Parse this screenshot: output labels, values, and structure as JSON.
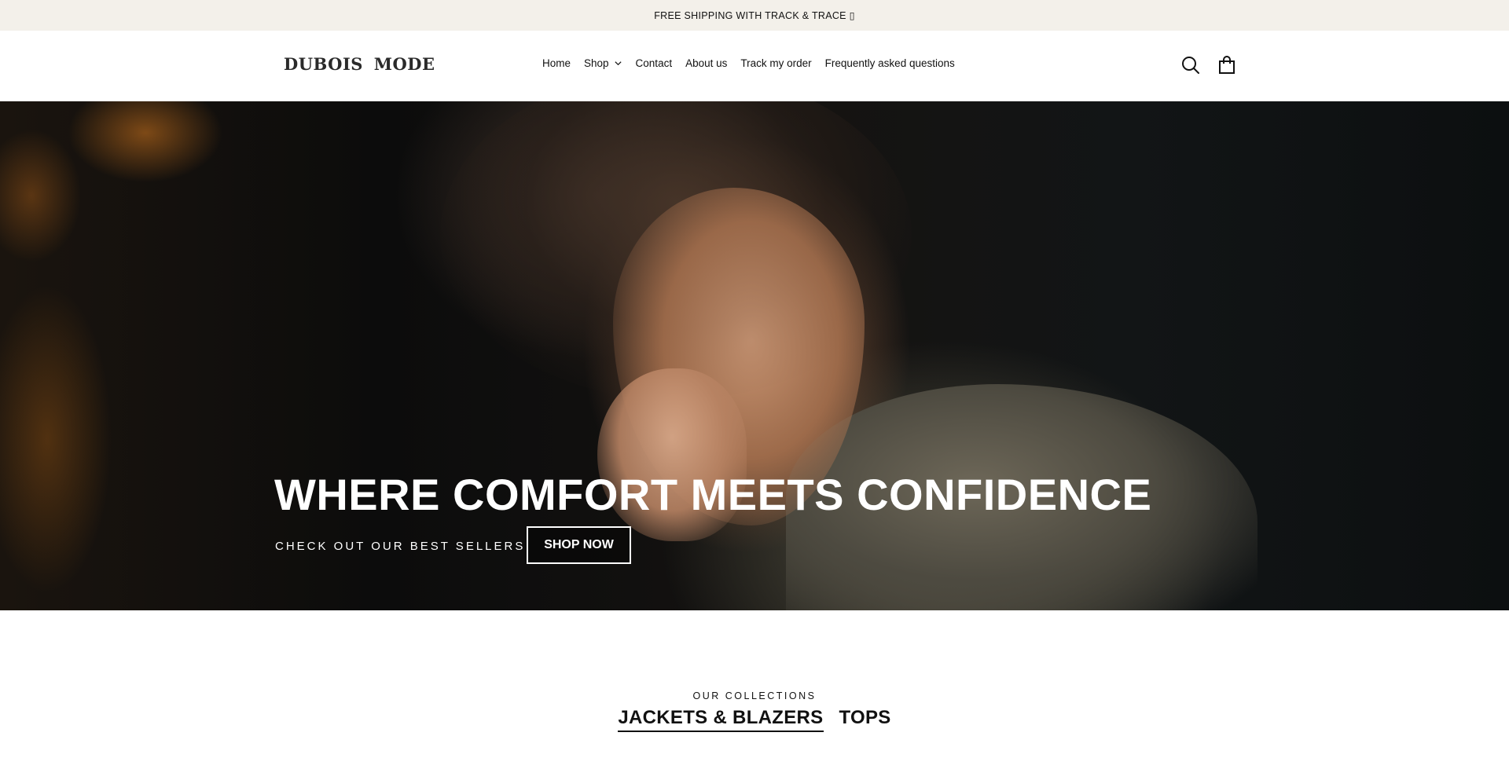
{
  "announcement": {
    "text": "FREE SHIPPING WITH TRACK & TRACE ▯"
  },
  "header": {
    "logo": "DUBOIS MODE",
    "nav": [
      {
        "label": "Home"
      },
      {
        "label": "Shop",
        "has_dropdown": true
      },
      {
        "label": "Contact"
      },
      {
        "label": "About us"
      },
      {
        "label": "Track my order"
      },
      {
        "label": "Frequently asked questions"
      }
    ],
    "icons": [
      "search-icon",
      "cart-bag-icon"
    ]
  },
  "hero": {
    "title": "WHERE COMFORT MEETS CONFIDENCE",
    "subtitle": "CHECK OUT OUR BEST SELLERS",
    "button_label": "SHOP NOW"
  },
  "collections": {
    "label": "OUR COLLECTIONS",
    "tabs": [
      {
        "label": "JACKETS & BLAZERS",
        "active": true
      },
      {
        "label": "TOPS",
        "active": false
      }
    ]
  },
  "colors": {
    "announcement_bg": "#f3f0ea",
    "text": "#111111",
    "hero_text": "#ffffff"
  }
}
